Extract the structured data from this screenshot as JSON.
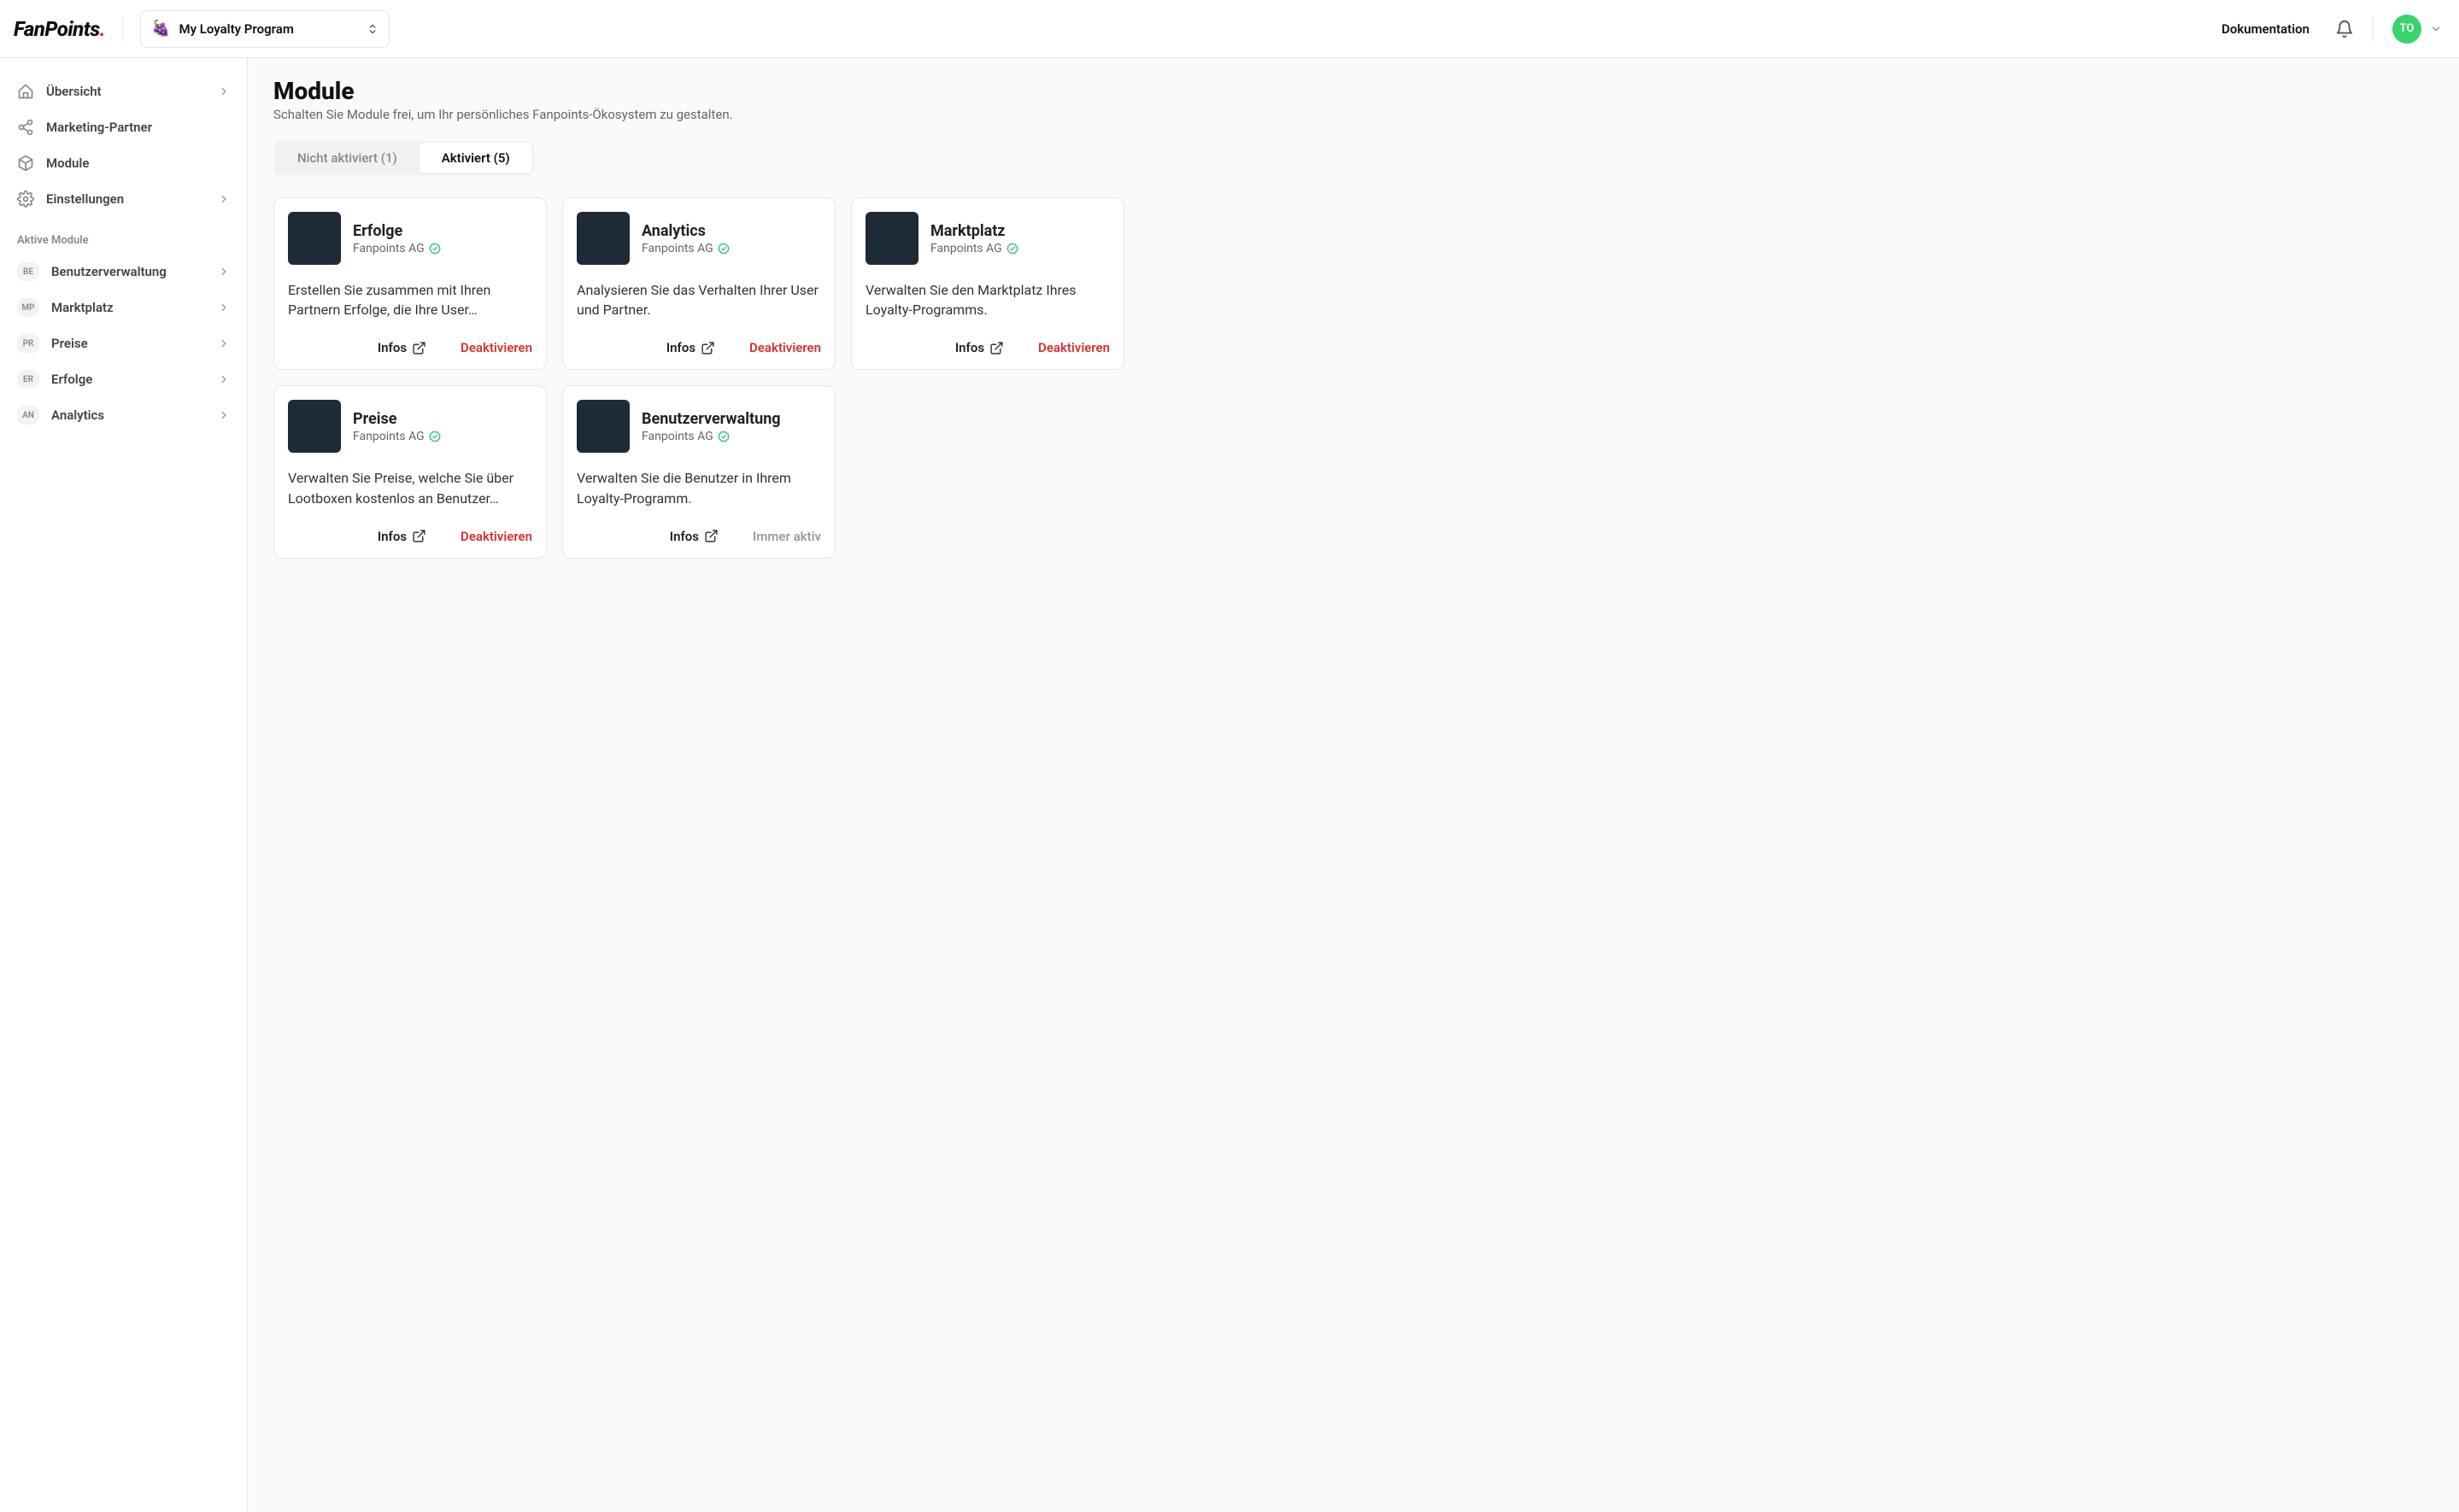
{
  "header": {
    "logo": "FanPoints",
    "program": "My Loyalty Program",
    "docLabel": "Dokumentation",
    "avatar": "TO"
  },
  "sidebar": {
    "items": [
      {
        "label": "Übersicht",
        "icon": "home",
        "expandable": true
      },
      {
        "label": "Marketing-Partner",
        "icon": "share",
        "expandable": false
      },
      {
        "label": "Module",
        "icon": "package",
        "expandable": false
      },
      {
        "label": "Einstellungen",
        "icon": "gear",
        "expandable": true
      }
    ],
    "activeHeading": "Aktive Module",
    "modules": [
      {
        "code": "BE",
        "label": "Benutzerverwaltung"
      },
      {
        "code": "MP",
        "label": "Marktplatz"
      },
      {
        "code": "PR",
        "label": "Preise"
      },
      {
        "code": "ER",
        "label": "Erfolge"
      },
      {
        "code": "AN",
        "label": "Analytics"
      }
    ]
  },
  "main": {
    "title": "Module",
    "subtitle": "Schalten Sie Module frei, um Ihr persönliches Fanpoints-Ökosystem zu gestalten.",
    "tabs": [
      {
        "label": "Nicht aktiviert (1)",
        "active": false
      },
      {
        "label": "Aktiviert (5)",
        "active": true
      }
    ],
    "infoLabel": "Infos",
    "deactivateLabel": "Deaktivieren",
    "alwaysActiveLabel": "Immer aktiv",
    "cards": [
      {
        "title": "Erfolge",
        "org": "Fanpoints AG",
        "desc": "Erstellen Sie zusammen mit Ihren Partnern Erfolge, die Ihre User…",
        "always": false
      },
      {
        "title": "Analytics",
        "org": "Fanpoints AG",
        "desc": "Analysieren Sie das Verhalten Ihrer User und Partner.",
        "always": false
      },
      {
        "title": "Marktplatz",
        "org": "Fanpoints AG",
        "desc": "Verwalten Sie den Marktplatz Ihres Loyalty-Programms.",
        "always": false
      },
      {
        "title": "Preise",
        "org": "Fanpoints AG",
        "desc": "Verwalten Sie Preise, welche Sie über Lootboxen kostenlos an Benutzer…",
        "always": false
      },
      {
        "title": "Benutzerverwaltung",
        "org": "Fanpoints AG",
        "desc": "Verwalten Sie die Benutzer in Ihrem Loyalty-Programm.",
        "always": true
      }
    ]
  }
}
